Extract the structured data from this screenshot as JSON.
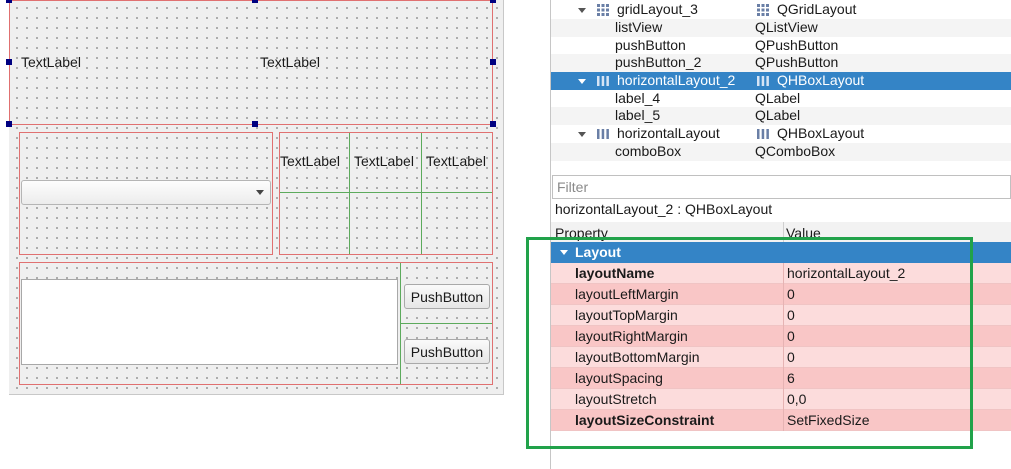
{
  "canvas": {
    "top_label_left": "TextLabel",
    "top_label_right": "TextLabel",
    "grid_labels": [
      "TextLabel",
      "TextLabel",
      "TextLabel"
    ],
    "push_button_1": "PushButton",
    "push_button_2": "PushButton"
  },
  "object_tree": {
    "rows": [
      {
        "name": "gridLayout_3",
        "class": "QGridLayout",
        "icon": "grid-layout-icon"
      },
      {
        "name": "listView",
        "class": "QListView"
      },
      {
        "name": "pushButton",
        "class": "QPushButton"
      },
      {
        "name": "pushButton_2",
        "class": "QPushButton"
      },
      {
        "name": "horizontalLayout_2",
        "class": "QHBoxLayout",
        "icon": "hbox-layout-icon",
        "selected": true
      },
      {
        "name": "label_4",
        "class": "QLabel"
      },
      {
        "name": "label_5",
        "class": "QLabel"
      },
      {
        "name": "horizontalLayout",
        "class": "QHBoxLayout",
        "icon": "hbox-layout-icon"
      },
      {
        "name": "comboBox",
        "class": "QComboBox"
      }
    ]
  },
  "property_editor": {
    "filter_placeholder": "Filter",
    "object_title": "horizontalLayout_2 : QHBoxLayout",
    "col_property": "Property",
    "col_value": "Value",
    "section": "Layout",
    "properties": [
      {
        "name": "layoutName",
        "value": "horizontalLayout_2"
      },
      {
        "name": "layoutLeftMargin",
        "value": "0"
      },
      {
        "name": "layoutTopMargin",
        "value": "0"
      },
      {
        "name": "layoutRightMargin",
        "value": "0"
      },
      {
        "name": "layoutBottomMargin",
        "value": "0"
      },
      {
        "name": "layoutSpacing",
        "value": "6"
      },
      {
        "name": "layoutStretch",
        "value": "0,0"
      },
      {
        "name": "layoutSizeConstraint",
        "value": "SetFixedSize"
      }
    ]
  },
  "colors": {
    "selection": "#3484c6",
    "highlight_box": "#21a24a",
    "modified_property_bg": "#fcdcdc",
    "layout_frame": "#e07070",
    "grid_line": "#5caa5c"
  }
}
